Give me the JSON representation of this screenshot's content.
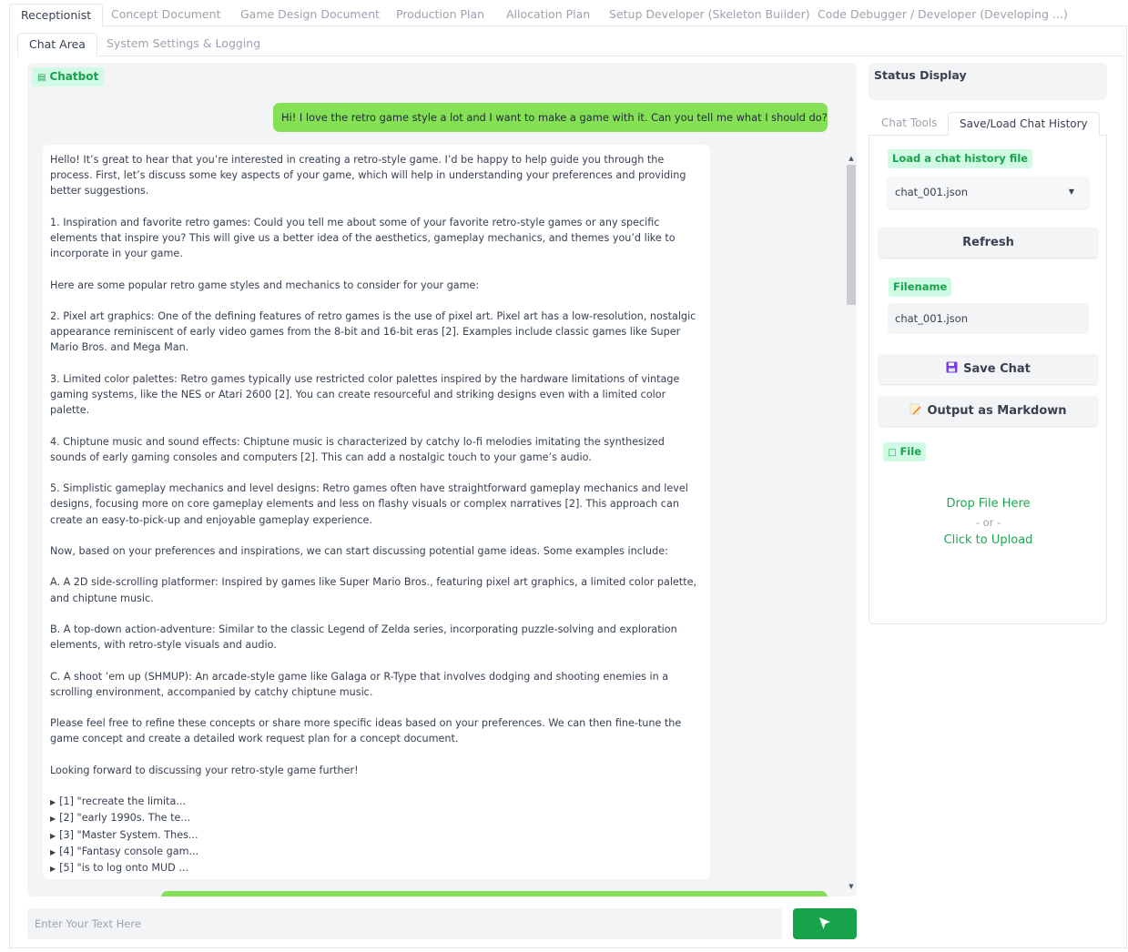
{
  "top_tabs": [
    {
      "label": "Receptionist",
      "active": true
    },
    {
      "label": "Concept Document"
    },
    {
      "label": "Game Design Document"
    },
    {
      "label": "Production Plan"
    },
    {
      "label": "Allocation Plan"
    },
    {
      "label": "Setup Developer (Skeleton Builder)"
    },
    {
      "label": "Code Debugger / Developer (Developing ...)"
    }
  ],
  "sub_tabs": [
    {
      "label": "Chat Area",
      "active": true
    },
    {
      "label": "System Settings & Logging"
    }
  ],
  "chat": {
    "label": "Chatbot",
    "user_message": "Hi! I love the retro game style a lot and I want to make a game with it. Can you tell me what I should do?",
    "bot_paragraphs": [
      "Hello! It’s great to hear that you’re interested in creating a retro-style game. I’d be happy to help guide you through the process. First, let’s discuss some key aspects of your game, which will help in understanding your preferences and providing better suggestions.",
      "1. Inspiration and favorite retro games: Could you tell me about some of your favorite retro-style games or any specific elements that inspire you? This will give us a better idea of the aesthetics, gameplay mechanics, and themes you’d like to incorporate in your game.",
      "Here are some popular retro game styles and mechanics to consider for your game:",
      "2. Pixel art graphics: One of the defining features of retro games is the use of pixel art. Pixel art has a low-resolution, nostalgic appearance reminiscent of early video games from the 8-bit and 16-bit eras [2]. Examples include classic games like Super Mario Bros. and Mega Man.",
      "3. Limited color palettes: Retro games typically use restricted color palettes inspired by the hardware limitations of vintage gaming systems, like the NES or Atari 2600 [2]. You can create resourceful and striking designs even with a limited color palette.",
      "4. Chiptune music and sound effects: Chiptune music is characterized by catchy lo-fi melodies imitating the synthesized sounds of early gaming consoles and computers [2]. This can add a nostalgic touch to your game’s audio.",
      "5. Simplistic gameplay mechanics and level designs: Retro games often have straightforward gameplay mechanics and level designs, focusing more on core gameplay elements and less on flashy visuals or complex narratives [2]. This approach can create an easy-to-pick-up and enjoyable gameplay experience.",
      "Now, based on your preferences and inspirations, we can start discussing potential game ideas. Some examples include:",
      "A. A 2D side-scrolling platformer: Inspired by games like Super Mario Bros., featuring pixel art graphics, a limited color palette, and chiptune music.",
      "B. A top-down action-adventure: Similar to the classic Legend of Zelda series, incorporating puzzle-solving and exploration elements, with retro-style visuals and audio.",
      "C. A shoot ’em up (SHMUP): An arcade-style game like Galaga or R-Type that involves dodging and shooting enemies in a scrolling environment, accompanied by catchy chiptune music.",
      "Please feel free to refine these concepts or share more specific ideas based on your preferences. We can then fine-tune the game concept and create a detailed work request plan for a concept document.",
      "Looking forward to discussing your retro-style game further!"
    ],
    "references": [
      "[1] \"recreate the limita...",
      "[2] \"early 1990s. The te...",
      "[3] \"Master System. Thes...",
      "[4] \"Fantasy console gam...",
      "[5] \"is to log onto MUD ..."
    ],
    "input_placeholder": "Enter Your Text Here",
    "send_icon": "cursor-arrow-icon"
  },
  "status": {
    "title": "Status Display"
  },
  "right_tabs": [
    {
      "label": "Chat Tools"
    },
    {
      "label": "Save/Load Chat History",
      "active": true
    }
  ],
  "history": {
    "load_label": "Load a chat history file",
    "selected_file": "chat_001.json",
    "refresh_label": "Refresh",
    "filename_label": "Filename",
    "filename_value": "chat_001.json",
    "save_label": "Save Chat",
    "markdown_label": "Output as Markdown",
    "file_label": "File",
    "drop_text": "Drop File Here",
    "or_text": "- or -",
    "upload_text": "Click to Upload"
  },
  "colors": {
    "accent_green": "#16a34a",
    "user_bubble": "#86e056",
    "label_bg": "#d1fae5"
  }
}
